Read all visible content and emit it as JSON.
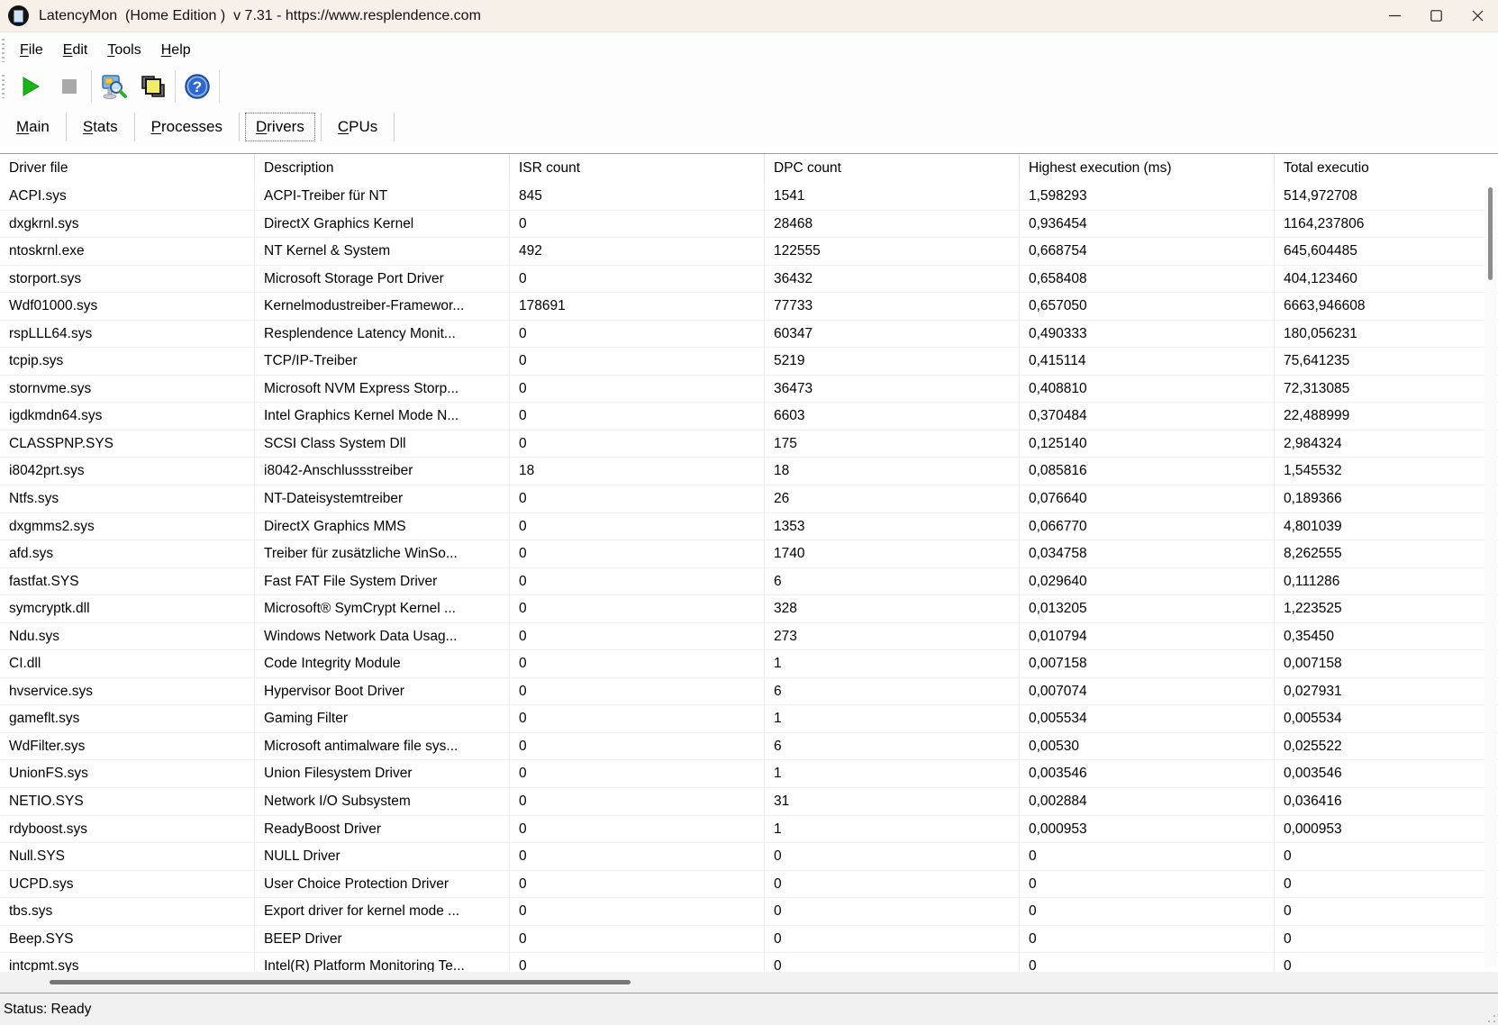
{
  "window": {
    "title": "LatencyMon  (Home Edition )  v 7.31 - https://www.resplendence.com"
  },
  "menu": {
    "items": [
      "File",
      "Edit",
      "Tools",
      "Help"
    ]
  },
  "toolbar": {
    "buttons": [
      "start-monitor",
      "stop-monitor",
      "analyze",
      "report",
      "help"
    ]
  },
  "tabs": {
    "items": [
      "Main",
      "Stats",
      "Processes",
      "Drivers",
      "CPUs"
    ],
    "active": "Drivers"
  },
  "table": {
    "columns": [
      "Driver file",
      "Description",
      "ISR count",
      "DPC count",
      "Highest execution (ms)",
      "Total executio"
    ],
    "rows": [
      {
        "file": "ACPI.sys",
        "desc": "ACPI-Treiber für NT",
        "isr": "845",
        "dpc": "1541",
        "highest": "1,598293",
        "total": "514,972708"
      },
      {
        "file": "dxgkrnl.sys",
        "desc": "DirectX Graphics Kernel",
        "isr": "0",
        "dpc": "28468",
        "highest": "0,936454",
        "total": "1164,237806"
      },
      {
        "file": "ntoskrnl.exe",
        "desc": "NT Kernel & System",
        "isr": "492",
        "dpc": "122555",
        "highest": "0,668754",
        "total": "645,604485"
      },
      {
        "file": "storport.sys",
        "desc": "Microsoft Storage Port Driver",
        "isr": "0",
        "dpc": "36432",
        "highest": "0,658408",
        "total": "404,123460"
      },
      {
        "file": "Wdf01000.sys",
        "desc": "Kernelmodustreiber-Framewor...",
        "isr": "178691",
        "dpc": "77733",
        "highest": "0,657050",
        "total": "6663,946608"
      },
      {
        "file": "rspLLL64.sys",
        "desc": "Resplendence Latency Monit...",
        "isr": "0",
        "dpc": "60347",
        "highest": "0,490333",
        "total": "180,056231"
      },
      {
        "file": "tcpip.sys",
        "desc": "TCP/IP-Treiber",
        "isr": "0",
        "dpc": "5219",
        "highest": "0,415114",
        "total": "75,641235"
      },
      {
        "file": "stornvme.sys",
        "desc": "Microsoft NVM Express Storp...",
        "isr": "0",
        "dpc": "36473",
        "highest": "0,408810",
        "total": "72,313085"
      },
      {
        "file": "igdkmdn64.sys",
        "desc": "Intel Graphics Kernel Mode N...",
        "isr": "0",
        "dpc": "6603",
        "highest": "0,370484",
        "total": "22,488999"
      },
      {
        "file": "CLASSPNP.SYS",
        "desc": "SCSI Class System Dll",
        "isr": "0",
        "dpc": "175",
        "highest": "0,125140",
        "total": "2,984324"
      },
      {
        "file": "i8042prt.sys",
        "desc": "i8042-Anschlussstreiber",
        "isr": "18",
        "dpc": "18",
        "highest": "0,085816",
        "total": "1,545532"
      },
      {
        "file": "Ntfs.sys",
        "desc": "NT-Dateisystemtreiber",
        "isr": "0",
        "dpc": "26",
        "highest": "0,076640",
        "total": "0,189366"
      },
      {
        "file": "dxgmms2.sys",
        "desc": "DirectX Graphics MMS",
        "isr": "0",
        "dpc": "1353",
        "highest": "0,066770",
        "total": "4,801039"
      },
      {
        "file": "afd.sys",
        "desc": "Treiber für zusätzliche WinSo...",
        "isr": "0",
        "dpc": "1740",
        "highest": "0,034758",
        "total": "8,262555"
      },
      {
        "file": "fastfat.SYS",
        "desc": "Fast FAT File System Driver",
        "isr": "0",
        "dpc": "6",
        "highest": "0,029640",
        "total": "0,111286"
      },
      {
        "file": "symcryptk.dll",
        "desc": "Microsoft® SymCrypt Kernel ...",
        "isr": "0",
        "dpc": "328",
        "highest": "0,013205",
        "total": "1,223525"
      },
      {
        "file": "Ndu.sys",
        "desc": "Windows Network Data Usag...",
        "isr": "0",
        "dpc": "273",
        "highest": "0,010794",
        "total": "0,35450"
      },
      {
        "file": "CI.dll",
        "desc": "Code Integrity Module",
        "isr": "0",
        "dpc": "1",
        "highest": "0,007158",
        "total": "0,007158"
      },
      {
        "file": "hvservice.sys",
        "desc": "Hypervisor Boot Driver",
        "isr": "0",
        "dpc": "6",
        "highest": "0,007074",
        "total": "0,027931"
      },
      {
        "file": "gameflt.sys",
        "desc": "Gaming Filter",
        "isr": "0",
        "dpc": "1",
        "highest": "0,005534",
        "total": "0,005534"
      },
      {
        "file": "WdFilter.sys",
        "desc": "Microsoft antimalware file sys...",
        "isr": "0",
        "dpc": "6",
        "highest": "0,00530",
        "total": "0,025522"
      },
      {
        "file": "UnionFS.sys",
        "desc": "Union Filesystem Driver",
        "isr": "0",
        "dpc": "1",
        "highest": "0,003546",
        "total": "0,003546"
      },
      {
        "file": "NETIO.SYS",
        "desc": "Network I/O Subsystem",
        "isr": "0",
        "dpc": "31",
        "highest": "0,002884",
        "total": "0,036416"
      },
      {
        "file": "rdyboost.sys",
        "desc": "ReadyBoost Driver",
        "isr": "0",
        "dpc": "1",
        "highest": "0,000953",
        "total": "0,000953"
      },
      {
        "file": "Null.SYS",
        "desc": "NULL Driver",
        "isr": "0",
        "dpc": "0",
        "highest": "0",
        "total": "0"
      },
      {
        "file": "UCPD.sys",
        "desc": "User Choice Protection Driver",
        "isr": "0",
        "dpc": "0",
        "highest": "0",
        "total": "0"
      },
      {
        "file": "tbs.sys",
        "desc": "Export driver for kernel mode ...",
        "isr": "0",
        "dpc": "0",
        "highest": "0",
        "total": "0"
      },
      {
        "file": "Beep.SYS",
        "desc": "BEEP Driver",
        "isr": "0",
        "dpc": "0",
        "highest": "0",
        "total": "0"
      },
      {
        "file": "intcpmt.sys",
        "desc": "Intel(R) Platform Monitoring Te...",
        "isr": "0",
        "dpc": "0",
        "highest": "0",
        "total": "0"
      }
    ]
  },
  "statusbar": {
    "text": "Status: Ready"
  },
  "colors": {
    "titlebar_bg": "#f7f0e9",
    "play_green": "#1ab31a",
    "stop_gray": "#a9a9a9",
    "help_blue": "#2f67cc",
    "report_yellow": "#f2ec6a",
    "monitor_blue": "#7db7e8"
  }
}
